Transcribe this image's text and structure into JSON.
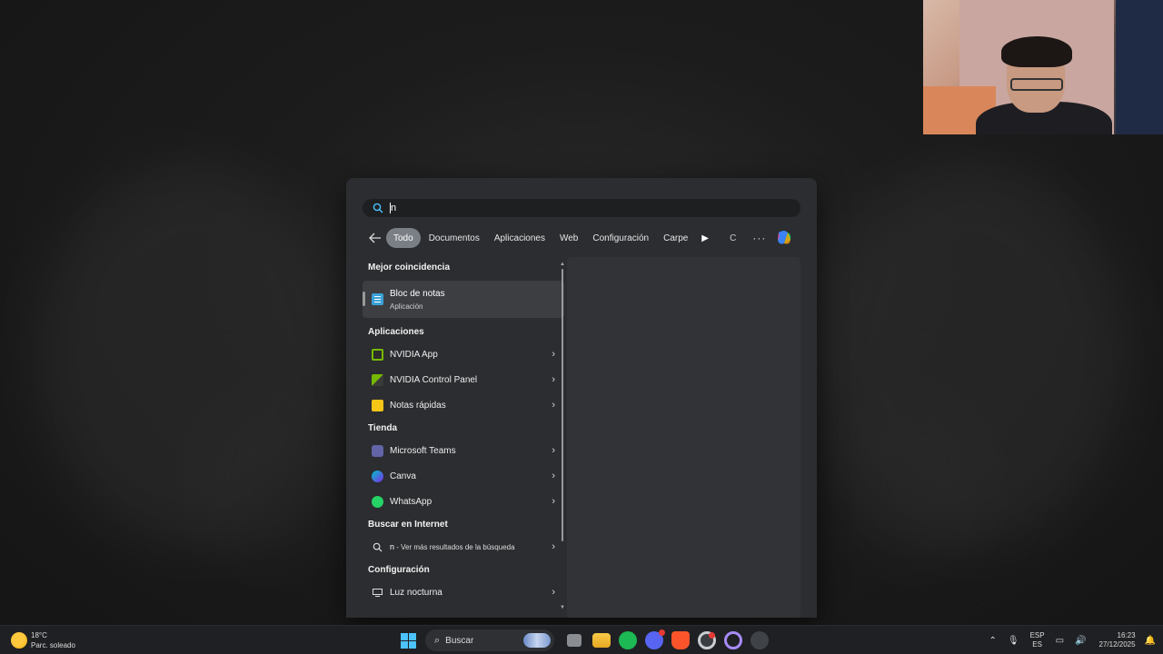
{
  "search": {
    "query": "n"
  },
  "filters": {
    "chips": [
      "Todo",
      "Documentos",
      "Aplicaciones",
      "Web",
      "Configuración",
      "Carpetas"
    ],
    "truncated_chip": "C"
  },
  "results": {
    "best_match_title": "Mejor coincidencia",
    "best_match": {
      "name": "Bloc de notas",
      "type": "Aplicación",
      "icon": "notepad-icon"
    },
    "apps_title": "Aplicaciones",
    "apps": [
      {
        "name": "NVIDIA App",
        "icon": "nvidia-app-icon"
      },
      {
        "name": "NVIDIA Control Panel",
        "icon": "nvidia-control-panel-icon"
      },
      {
        "name": "Notas rápidas",
        "icon": "sticky-notes-icon"
      }
    ],
    "store_title": "Tienda",
    "store": [
      {
        "name": "Microsoft Teams",
        "icon": "teams-icon"
      },
      {
        "name": "Canva",
        "icon": "canva-icon"
      },
      {
        "name": "WhatsApp",
        "icon": "whatsapp-icon"
      }
    ],
    "web_title": "Buscar en Internet",
    "web": {
      "query": "n",
      "suffix": " - Ver más resultados de la búsqueda"
    },
    "settings_title": "Configuración",
    "settings": [
      {
        "name": "Luz nocturna",
        "icon": "night-light-icon"
      }
    ]
  },
  "taskbar": {
    "weather": {
      "temp": "18°C",
      "condition": "Parc. soleado"
    },
    "search_placeholder": "Buscar",
    "lang_top": "ESP",
    "lang_bottom": "ES",
    "time": "16:23",
    "date": "27/12/2025"
  },
  "colors": {
    "accent": "#4cc2ff",
    "panel": "#2b2d30",
    "taskbar": "#1f2023"
  }
}
